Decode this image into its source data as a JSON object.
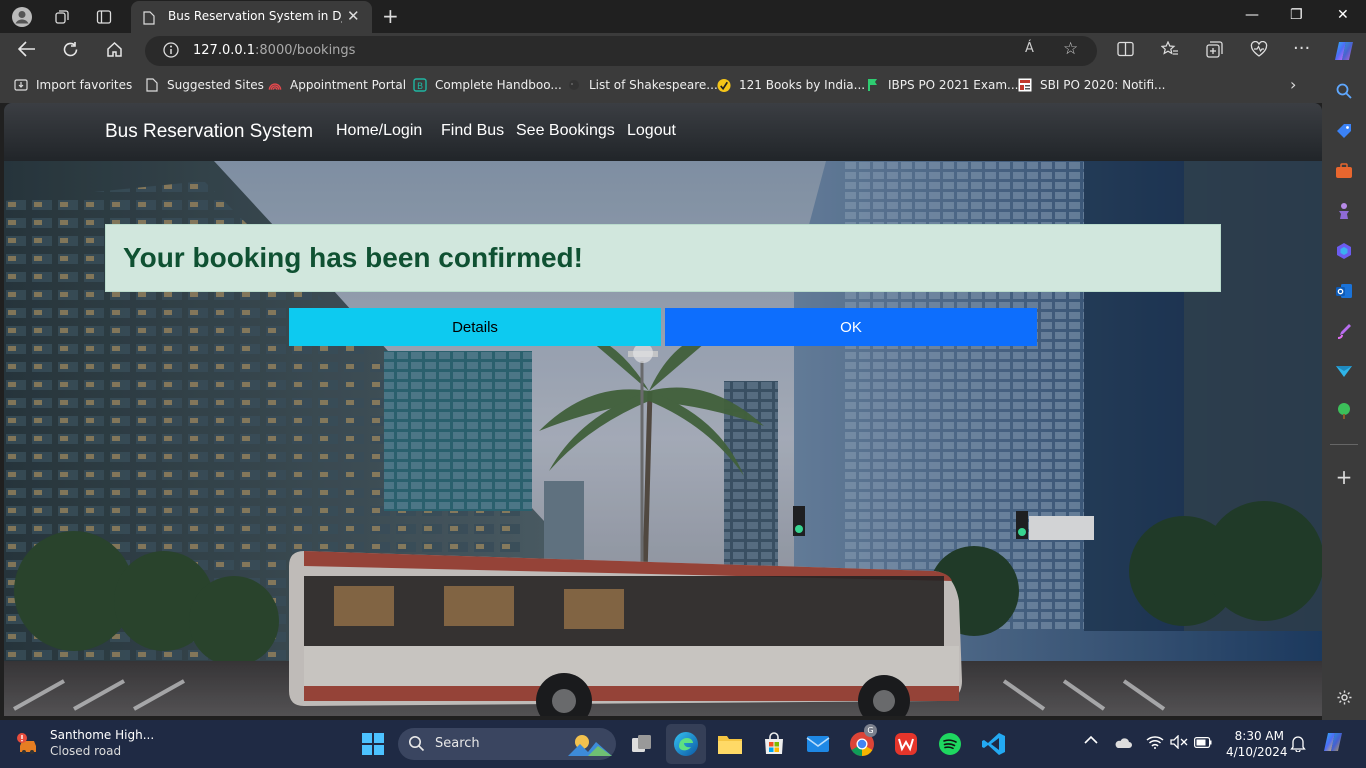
{
  "browser": {
    "tab_title": "Bus Reservation System in Djang",
    "url_host": "127.0.0.1",
    "url_path": ":8000/bookings",
    "read_aloud_label": "Á"
  },
  "favorites": [
    {
      "label": "Import favorites",
      "icon": "import-icon"
    },
    {
      "label": "Suggested Sites",
      "icon": "page-icon"
    },
    {
      "label": "Appointment Portal",
      "icon": "portal-icon"
    },
    {
      "label": "Complete Handboo...",
      "icon": "book-icon"
    },
    {
      "label": "List of Shakespeare...",
      "icon": "quill-icon"
    },
    {
      "label": "121 Books by India...",
      "icon": "books-icon"
    },
    {
      "label": "IBPS PO 2021 Exam...",
      "icon": "flag-icon"
    },
    {
      "label": "SBI PO 2020: Notifi...",
      "icon": "news-icon"
    }
  ],
  "site": {
    "brand": "Bus Reservation System",
    "nav": [
      "Home/Login",
      "Find Bus",
      "See Bookings",
      "Logout"
    ],
    "alert_message": "Your booking has been confirmed!",
    "details_button": "Details",
    "ok_button": "OK"
  },
  "taskbar": {
    "weather_title": "Santhome High...",
    "weather_subtitle": "Closed road",
    "search_label": "Search",
    "time": "8:30 AM",
    "date": "4/10/2024",
    "chrome_badge": "G"
  },
  "colors": {
    "alert_bg": "#d1e7dd",
    "alert_text": "#0f5132",
    "details_bg": "#0dcaf0",
    "ok_bg": "#0d6efd",
    "navbar_bg": "#212529"
  }
}
